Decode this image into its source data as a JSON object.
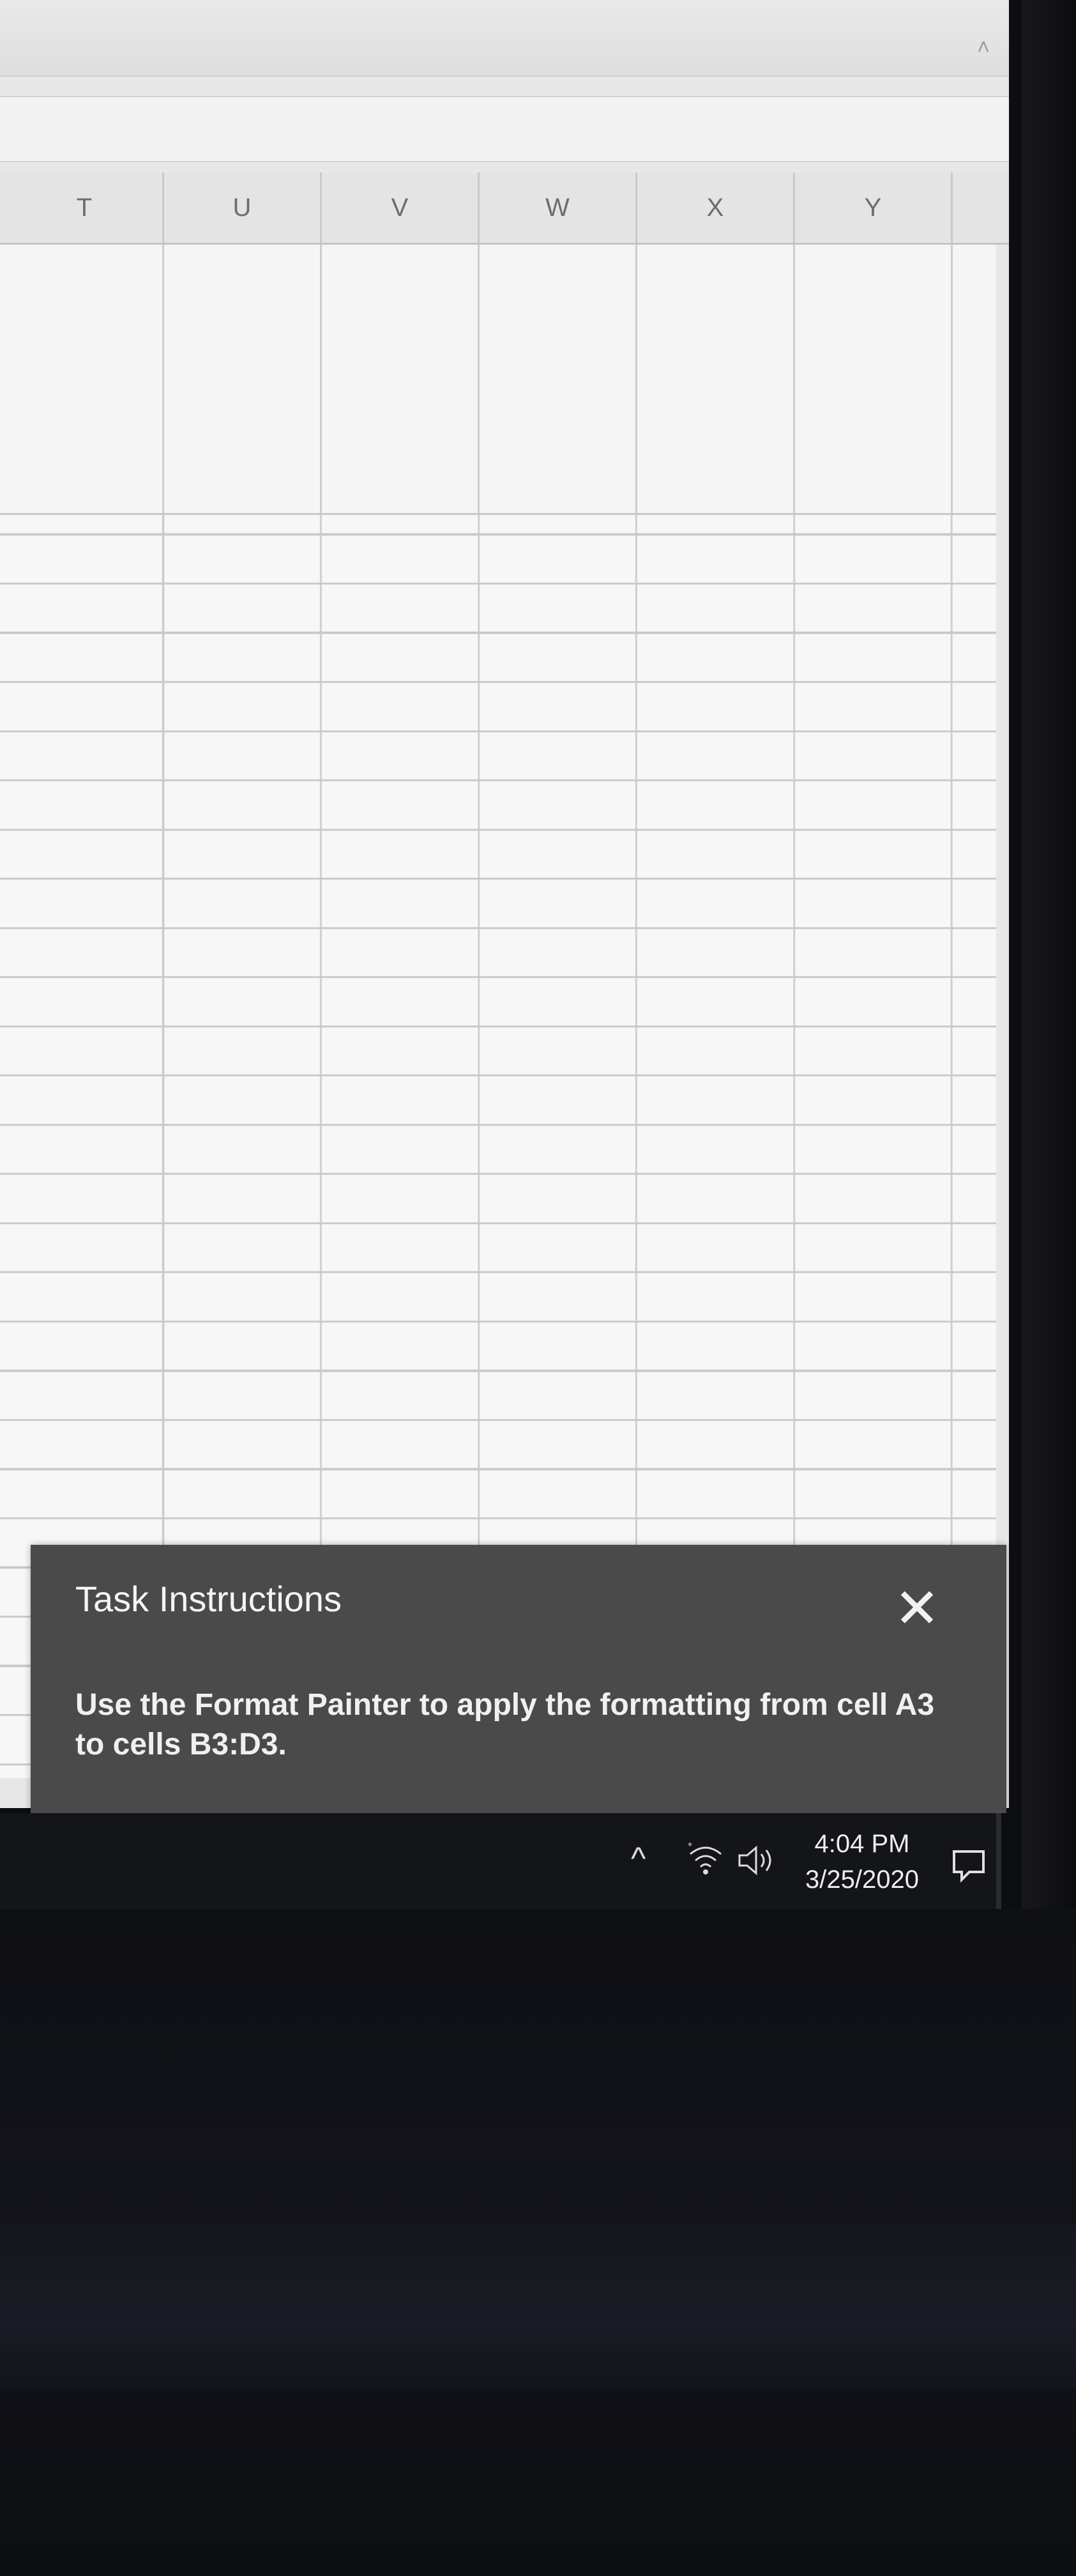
{
  "spreadsheet": {
    "column_headers": [
      "T",
      "U",
      "V",
      "W",
      "X",
      "Y"
    ]
  },
  "task_instructions": {
    "title": "Task Instructions",
    "body": "Use the Format Painter to apply the formatting from cell A3 to cells B3:D3.",
    "close_glyph": "✕"
  },
  "taskbar": {
    "time": "4:04 PM",
    "date": "3/25/2020"
  },
  "icons": {
    "ribbon_collapse": "chevron-up-icon",
    "formula_expand": "chevron-down-icon",
    "scroll_up": "scroll-up-icon",
    "tray_chevron": "chevron-up-icon",
    "wifi": "wifi-icon",
    "volume": "volume-icon",
    "notifications": "notifications-icon"
  }
}
